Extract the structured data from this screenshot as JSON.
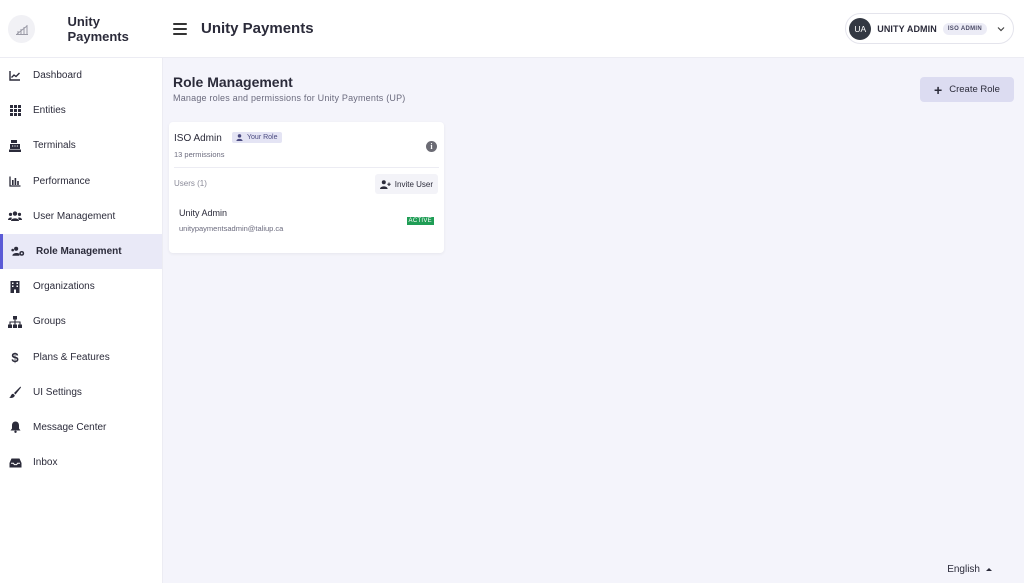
{
  "app": {
    "brand_name": "Unity Payments",
    "header_title": "Unity Payments"
  },
  "user": {
    "initials": "UA",
    "name": "UNITY ADMIN",
    "role_badge": "ISO ADMIN"
  },
  "sidebar": {
    "items": [
      {
        "label": "Dashboard",
        "icon": "chart-line-icon"
      },
      {
        "label": "Entities",
        "icon": "grid-icon"
      },
      {
        "label": "Terminals",
        "icon": "cash-register-icon"
      },
      {
        "label": "Performance",
        "icon": "bar-chart-icon"
      },
      {
        "label": "User Management",
        "icon": "users-icon"
      },
      {
        "label": "Role Management",
        "icon": "users-cog-icon",
        "active": true
      },
      {
        "label": "Organizations",
        "icon": "building-icon"
      },
      {
        "label": "Groups",
        "icon": "sitemap-icon"
      },
      {
        "label": "Plans & Features",
        "icon": "dollar-icon"
      },
      {
        "label": "UI Settings",
        "icon": "brush-icon"
      },
      {
        "label": "Message Center",
        "icon": "bell-icon"
      },
      {
        "label": "Inbox",
        "icon": "inbox-icon"
      }
    ]
  },
  "main": {
    "title": "Role Management",
    "subtitle": "Manage roles and permissions for Unity Payments (UP)",
    "create_button": "Create Role",
    "role_card": {
      "role_name": "ISO Admin",
      "your_role_badge": "Your Role",
      "permissions": "13 permissions",
      "users_label": "Users (1)",
      "invite_button": "Invite User",
      "users": [
        {
          "name": "Unity Admin",
          "email": "unitypaymentsadmin@taliup.ca",
          "status": "ACTIVE"
        }
      ]
    }
  },
  "footer": {
    "language": "English"
  },
  "colors": {
    "accent": "#5b5bd6",
    "active_bg": "#e9e9f7",
    "status_active": "#1f9d55",
    "page_bg": "#f4f4fb"
  }
}
